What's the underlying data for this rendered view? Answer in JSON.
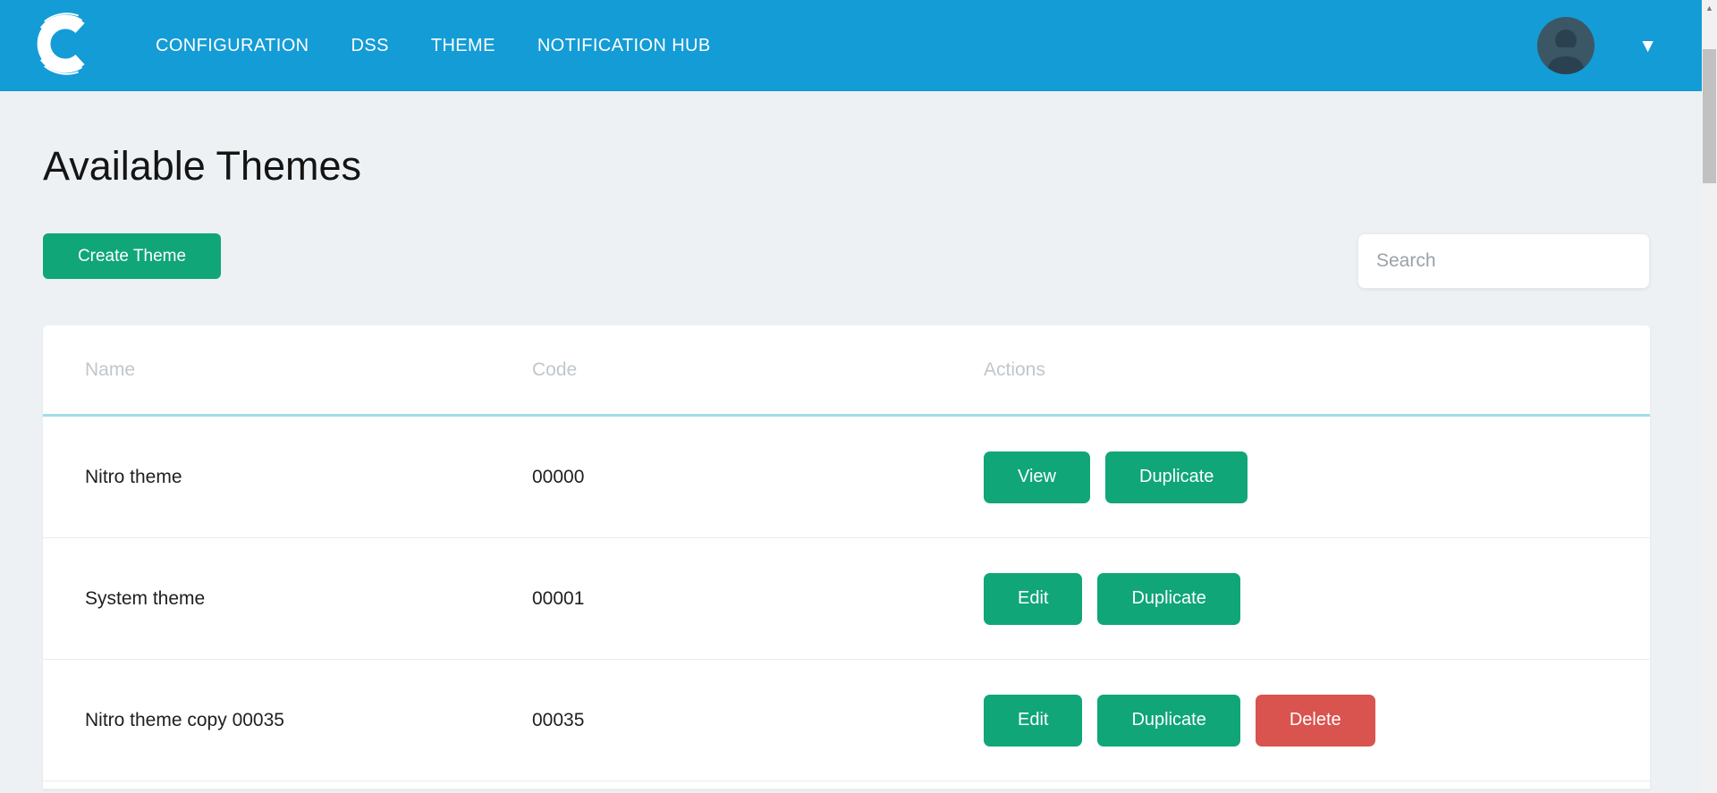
{
  "navbar": {
    "brand": "C",
    "items": [
      {
        "label": "CONFIGURATION"
      },
      {
        "label": "DSS"
      },
      {
        "label": "THEME"
      },
      {
        "label": "NOTIFICATION HUB"
      }
    ]
  },
  "page": {
    "title": "Available Themes"
  },
  "toolbar": {
    "create_label": "Create Theme",
    "search_placeholder": "Search",
    "search_value": ""
  },
  "table": {
    "headers": [
      "Name",
      "Code",
      "Actions"
    ],
    "rows": [
      {
        "name": "Nitro theme",
        "code": "00000",
        "actions": [
          "View",
          "Duplicate"
        ]
      },
      {
        "name": "System theme",
        "code": "00001",
        "actions": [
          "Edit",
          "Duplicate"
        ]
      },
      {
        "name": "Nitro theme copy 00035",
        "code": "00035",
        "actions": [
          "Edit",
          "Duplicate",
          "Delete"
        ]
      }
    ]
  },
  "icons": {
    "logo": "brand-c",
    "avatar": "person",
    "caret_down": "▼",
    "scroll_up": "▲"
  },
  "colors": {
    "navbar_blue": "#149cd6",
    "accent_green": "#10a678",
    "danger_red": "#d9534f",
    "page_background": "#edf1f4",
    "header_underline": "#a4dbe8",
    "header_text": "#c0c7cc"
  }
}
